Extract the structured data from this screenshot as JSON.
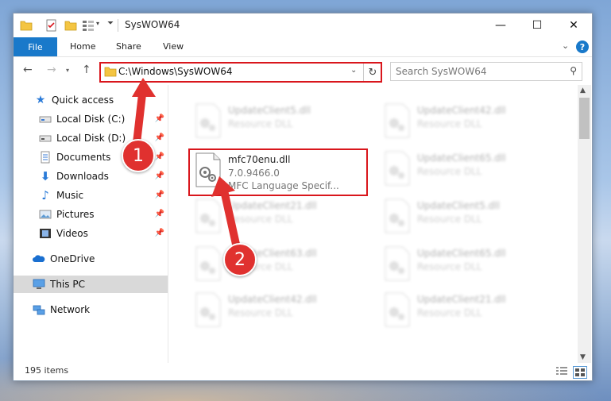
{
  "window": {
    "title": "SysWOW64"
  },
  "ribbon": {
    "tabs": [
      "File",
      "Home",
      "Share",
      "View"
    ],
    "help": "?"
  },
  "nav": {
    "address": "C:\\Windows\\SysWOW64",
    "search_placeholder": "Search SysWOW64"
  },
  "sidebar": {
    "items": [
      {
        "label": "Quick access",
        "icon": "star-icon",
        "pinned": false
      },
      {
        "label": "Local Disk (C:)",
        "icon": "drive-icon",
        "pinned": true
      },
      {
        "label": "Local Disk (D:)",
        "icon": "drive-icon",
        "pinned": true
      },
      {
        "label": "Documents",
        "icon": "documents-icon",
        "pinned": true
      },
      {
        "label": "Downloads",
        "icon": "download-icon",
        "pinned": true
      },
      {
        "label": "Music",
        "icon": "music-icon",
        "pinned": true
      },
      {
        "label": "Pictures",
        "icon": "pictures-icon",
        "pinned": true
      },
      {
        "label": "Videos",
        "icon": "videos-icon",
        "pinned": true
      },
      {
        "label": "OneDrive",
        "icon": "cloud-icon",
        "pinned": false
      },
      {
        "label": "This PC",
        "icon": "computer-icon",
        "pinned": false,
        "selected": true
      },
      {
        "label": "Network",
        "icon": "network-icon",
        "pinned": false
      }
    ]
  },
  "files": {
    "left": [
      {
        "name": "UpdateClient5.dll",
        "type": "Resource DLL",
        "blurred": true
      },
      {
        "name": "mfc70enu.dll",
        "version": "7.0.9466.0",
        "desc": "MFC Language Specif...",
        "blurred": false,
        "highlighted": true
      },
      {
        "name": "UpdateClient21.dll",
        "type": "Resource DLL",
        "blurred": true
      },
      {
        "name": "UpdateClient63.dll",
        "type": "Resource DLL",
        "blurred": true
      },
      {
        "name": "UpdateClient42.dll",
        "type": "Resource DLL",
        "blurred": true
      }
    ],
    "right": [
      {
        "name": "UpdateClient42.dll",
        "type": "Resource DLL"
      },
      {
        "name": "UpdateClient65.dll",
        "type": "Resource DLL"
      },
      {
        "name": "UpdateClient5.dll",
        "type": "Resource DLL"
      },
      {
        "name": "UpdateClient65.dll",
        "type": "Resource DLL"
      },
      {
        "name": "UpdateClient21.dll",
        "type": "Resource DLL"
      }
    ]
  },
  "status": {
    "item_count": "195 items"
  },
  "annotations": {
    "badge1": "1",
    "badge2": "2",
    "color": "#e0312f"
  }
}
